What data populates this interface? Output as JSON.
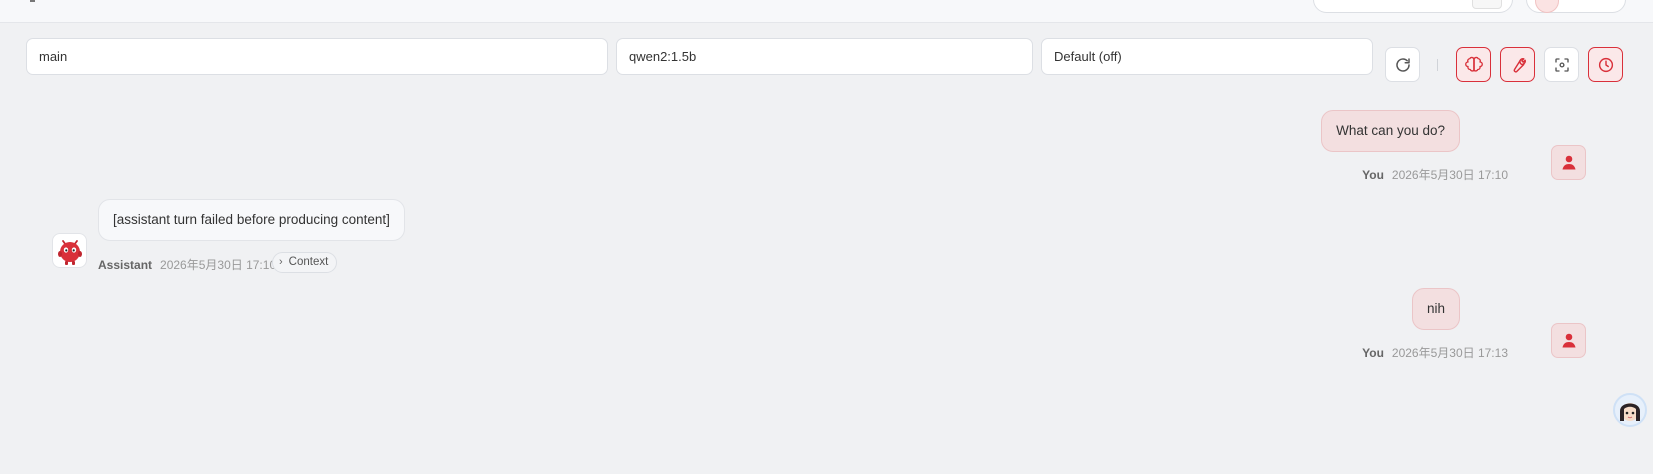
{
  "selectors": {
    "branch": "main",
    "model": "qwen2:1.5b",
    "mode": "Default (off)"
  },
  "toolbar": {
    "icons": [
      "refresh-icon",
      "brain-icon",
      "wrench-icon",
      "focus-icon",
      "clock-icon"
    ],
    "accent": "#d9303a"
  },
  "messages": [
    {
      "role": "user",
      "author": "You",
      "text": "What can you do?",
      "time": "2026年5月30日 17:10"
    },
    {
      "role": "assistant",
      "author": "Assistant",
      "text": "[assistant turn failed before producing content]",
      "time": "2026年5月30日 17:10",
      "context_label": "Context"
    },
    {
      "role": "user",
      "author": "You",
      "text": "nih",
      "time": "2026年5月30日 17:13"
    }
  ]
}
